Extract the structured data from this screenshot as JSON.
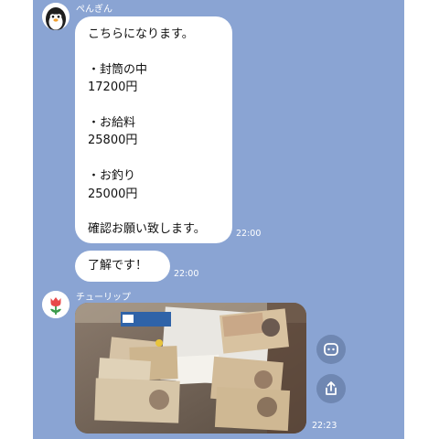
{
  "messages": [
    {
      "sender": "ぺんぎん",
      "avatar_icon": "penguin-icon",
      "text": "こちらになります。\n\n・封筒の中\n17200円\n\n・お給料\n25800円\n\n・お釣り\n25000円\n\n確認お願い致します。",
      "time": "22:00"
    },
    {
      "sender": "ぺんぎん",
      "text": "了解です！",
      "time": "22:00"
    },
    {
      "sender": "チューリップ",
      "avatar_icon": "tulip-icon",
      "attachment": "photo",
      "time": "22:23"
    }
  ],
  "photo_actions": [
    "save-icon",
    "share-icon"
  ],
  "colors": {
    "chat_background": "#8aa4d3",
    "bubble": "#ffffff",
    "penguin_beak": "#f0a030",
    "tulip": "#e8484a",
    "tulip_stem": "#3a9a4a"
  }
}
